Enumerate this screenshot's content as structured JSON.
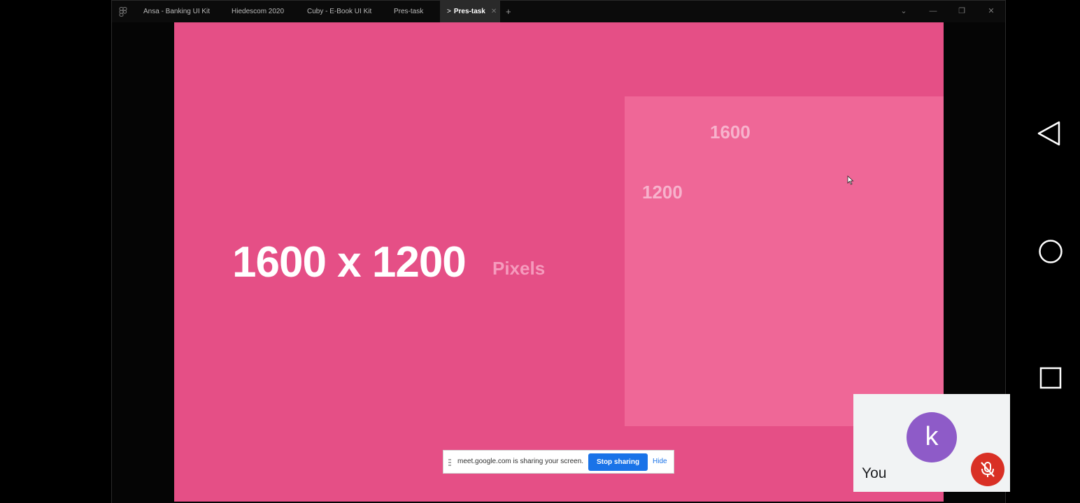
{
  "window": {
    "tabs": [
      {
        "label": "Ansa - Banking UI Kit"
      },
      {
        "label": "Hiedescom 2020"
      },
      {
        "label": "Cuby - E-Book UI Kit"
      },
      {
        "label": "Pres-task"
      },
      {
        "label": "Pres-task",
        "active": true
      }
    ],
    "add_tab_label": "+",
    "controls": {
      "chevron": "⌄",
      "minimize": "—",
      "maximize": "❐",
      "close": "✕"
    }
  },
  "canvas": {
    "background_color": "#e54f86",
    "headline": "1600 x 1200",
    "headline_sub": "Pixels",
    "dimension_width": "1600",
    "dimension_height": "1200"
  },
  "share_banner": {
    "text": "meet.google.com is sharing your screen.",
    "stop_label": "Stop sharing",
    "hide_label": "Hide"
  },
  "android_nav": {
    "back": "back-icon",
    "home": "home-icon",
    "recents": "recents-icon"
  },
  "self_view": {
    "avatar_letter": "k",
    "name": "You",
    "avatar_color": "#8e5bc8",
    "mic_status": "muted"
  }
}
